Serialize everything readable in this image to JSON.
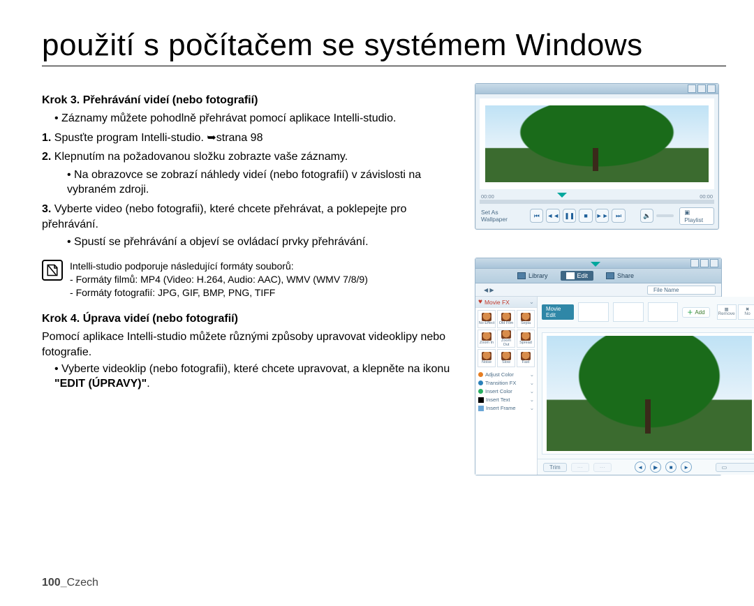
{
  "title": "použití s počítačem se systémem Windows",
  "step3": {
    "heading": "Krok 3. Přehrávání videí (nebo fotografií)",
    "intro_bullet": "Záznamy můžete pohodlně přehrávat pomocí aplikace Intelli-studio.",
    "items": [
      {
        "n": "1.",
        "text": "Spusťte program Intelli-studio. ",
        "page": "➥strana 98"
      },
      {
        "n": "2.",
        "text": "Klepnutím na požadovanou složku zobrazte vaše záznamy.",
        "sub": "Na obrazovce se zobrazí náhledy videí (nebo fotografií) v závislosti na vybraném zdroji."
      },
      {
        "n": "3.",
        "text": "Vyberte video (nebo fotografii), které chcete přehrávat, a poklepejte pro přehrávání.",
        "sub": "Spustí se přehrávání a objeví se ovládací prvky přehrávání."
      }
    ],
    "note": {
      "line1": "Intelli-studio podporuje následující formáty souborů:",
      "line2": "Formáty filmů: MP4 (Video: H.264, Audio: AAC), WMV (WMV 7/8/9)",
      "line3": "Formáty fotografií: JPG, GIF, BMP, PNG, TIFF"
    }
  },
  "step4": {
    "heading": "Krok 4. Úprava videí (nebo fotografií)",
    "para": "Pomocí aplikace Intelli-studio můžete různými způsoby upravovat videoklipy nebo fotografie.",
    "bullet_pre": "Vyberte videoklip (nebo fotografii), které chcete upravovat, a klepněte na ikonu ",
    "bullet_bold": "\"EDIT (ÚPRAVY)\"",
    "bullet_post": "."
  },
  "footer": {
    "page": "100_",
    "lang": "Czech"
  },
  "player": {
    "wallpaper": "Set As Wallpaper",
    "playlist": "Playlist",
    "time_l": "00:00",
    "time_r": "00:00"
  },
  "editor": {
    "tabs": {
      "library": "Library",
      "edit": "Edit",
      "share": "Share"
    },
    "filename": "File Name",
    "moviefx": "Movie FX",
    "fx": [
      "No Effect",
      "Old Film",
      "Sepia",
      "Zoom In",
      "Zoom Out",
      "Spread",
      "Noise",
      "Slow",
      "Fast"
    ],
    "side": [
      {
        "icon": "#e67e22",
        "label": "Adjust Color"
      },
      {
        "icon": "#2980b9",
        "label": "Transition FX"
      },
      {
        "icon": "#27ae60",
        "label": "Insert Color"
      },
      {
        "icon": "#000000",
        "label": "Insert Text"
      },
      {
        "icon": "#6aa6d6",
        "label": "Insert Frame"
      }
    ],
    "chip": "Movie Edit",
    "add": "Add",
    "remove": "Remove",
    "no": "No",
    "trim": "Trim"
  }
}
